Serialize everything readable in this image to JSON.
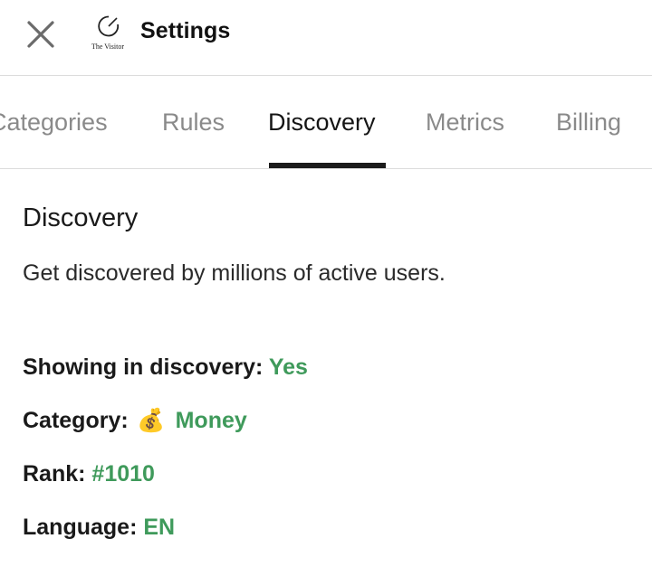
{
  "header": {
    "title": "Settings",
    "logo_text": "The Visitor",
    "close_icon": "close-icon",
    "logo_icon": "visitor-logo-icon"
  },
  "tabs": [
    {
      "label": "Categories",
      "active": false
    },
    {
      "label": "Rules",
      "active": false
    },
    {
      "label": "Discovery",
      "active": true
    },
    {
      "label": "Metrics",
      "active": false
    },
    {
      "label": "Billing",
      "active": false
    }
  ],
  "discovery": {
    "title": "Discovery",
    "description": "Get discovered by millions of active users.",
    "showing_label": "Showing in discovery:",
    "showing_value": "Yes",
    "category_label": "Category:",
    "category_emoji": "💰",
    "category_value": "Money",
    "rank_label": "Rank:",
    "rank_value": "#1010",
    "language_label": "Language:",
    "language_value": "EN"
  },
  "colors": {
    "accent_green": "#3f9a5b",
    "tab_inactive": "#8a8a8a",
    "tab_active": "#151515",
    "divider": "#dcdcdc"
  }
}
